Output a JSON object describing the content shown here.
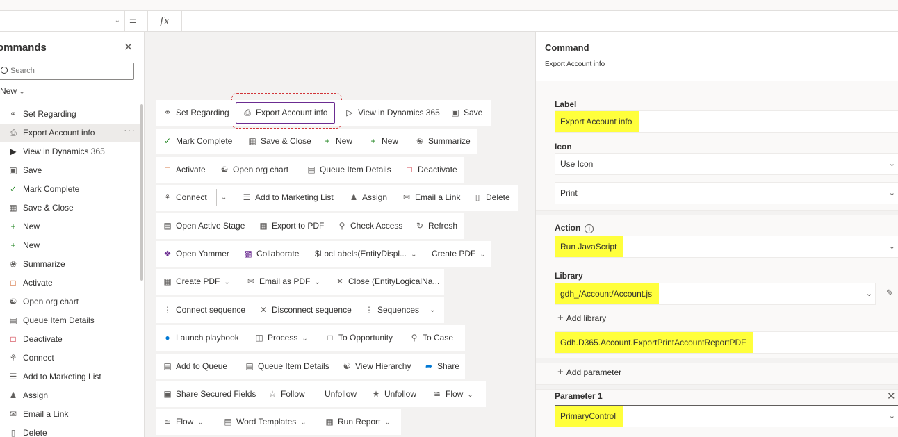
{
  "formula_bar": {
    "fx": "fx",
    "equals": "="
  },
  "left_pane": {
    "title": "ommands",
    "search_placeholder": "Search",
    "new_label": "New",
    "items": [
      {
        "icon": "link-icon",
        "label": "Set Regarding"
      },
      {
        "icon": "print-icon",
        "label": "Export Account info",
        "selected": true
      },
      {
        "icon": "dynamics-icon",
        "label": "View in Dynamics 365"
      },
      {
        "icon": "save-icon",
        "label": "Save"
      },
      {
        "icon": "check-icon",
        "label": "Mark Complete"
      },
      {
        "icon": "save-close-icon",
        "label": "Save & Close"
      },
      {
        "icon": "plus-icon",
        "label": "New"
      },
      {
        "icon": "plus-icon",
        "label": "New"
      },
      {
        "icon": "summarize-icon",
        "label": "Summarize"
      },
      {
        "icon": "activate-icon",
        "label": "Activate"
      },
      {
        "icon": "org-chart-icon",
        "label": "Open org chart"
      },
      {
        "icon": "queue-icon",
        "label": "Queue Item Details"
      },
      {
        "icon": "deactivate-icon",
        "label": "Deactivate"
      },
      {
        "icon": "connect-icon",
        "label": "Connect"
      },
      {
        "icon": "marketing-list-icon",
        "label": "Add to Marketing List"
      },
      {
        "icon": "assign-icon",
        "label": "Assign"
      },
      {
        "icon": "email-link-icon",
        "label": "Email a Link"
      },
      {
        "icon": "delete-icon",
        "label": "Delete"
      }
    ]
  },
  "canvas": {
    "rows": [
      [
        "Set Regarding",
        "Export Account info",
        "View in Dynamics 365",
        "Save"
      ],
      [
        "Mark Complete",
        "Save & Close",
        "New",
        "New",
        "Summarize"
      ],
      [
        "Activate",
        "Open org chart",
        "Queue Item Details",
        "Deactivate"
      ],
      [
        "Connect",
        "Add to Marketing List",
        "Assign",
        "Email a Link",
        "Delete"
      ],
      [
        "Open Active Stage",
        "Export to PDF",
        "Check Access",
        "Refresh"
      ],
      [
        "Open Yammer",
        "Collaborate",
        "$LocLabels(EntityDispl...",
        "Create PDF"
      ],
      [
        "Create PDF",
        "Email as PDF",
        "Close (EntityLogicalNa..."
      ],
      [
        "Connect sequence",
        "Disconnect sequence",
        "Sequences"
      ],
      [
        "Launch playbook",
        "Process",
        "To Opportunity",
        "To Case"
      ],
      [
        "Add to Queue",
        "Queue Item Details",
        "View Hierarchy",
        "Share"
      ],
      [
        "Share Secured Fields",
        "Follow",
        "Unfollow",
        "Unfollow",
        "Flow"
      ],
      [
        "Flow",
        "Word Templates",
        "Run Report"
      ]
    ]
  },
  "right_pane": {
    "title": "Command",
    "subtitle": "Export Account info",
    "label_heading": "Label",
    "label_value": "Export Account info",
    "icon_heading": "Icon",
    "icon_mode": "Use Icon",
    "icon_value": "Print",
    "action_heading": "Action",
    "action_value": "Run JavaScript",
    "library_heading": "Library",
    "library_value": "gdh_/Account/Account.js",
    "add_library": "Add library",
    "function_value": "Gdh.D365.Account.ExportPrintAccountReportPDF",
    "add_parameter": "Add parameter",
    "parameter1_heading": "Parameter 1",
    "parameter1_value": "PrimaryControl"
  },
  "colors": {
    "highlight": "#ffff3c",
    "selection_border": "#6b2c91",
    "dashed_outline": "#d13438"
  }
}
